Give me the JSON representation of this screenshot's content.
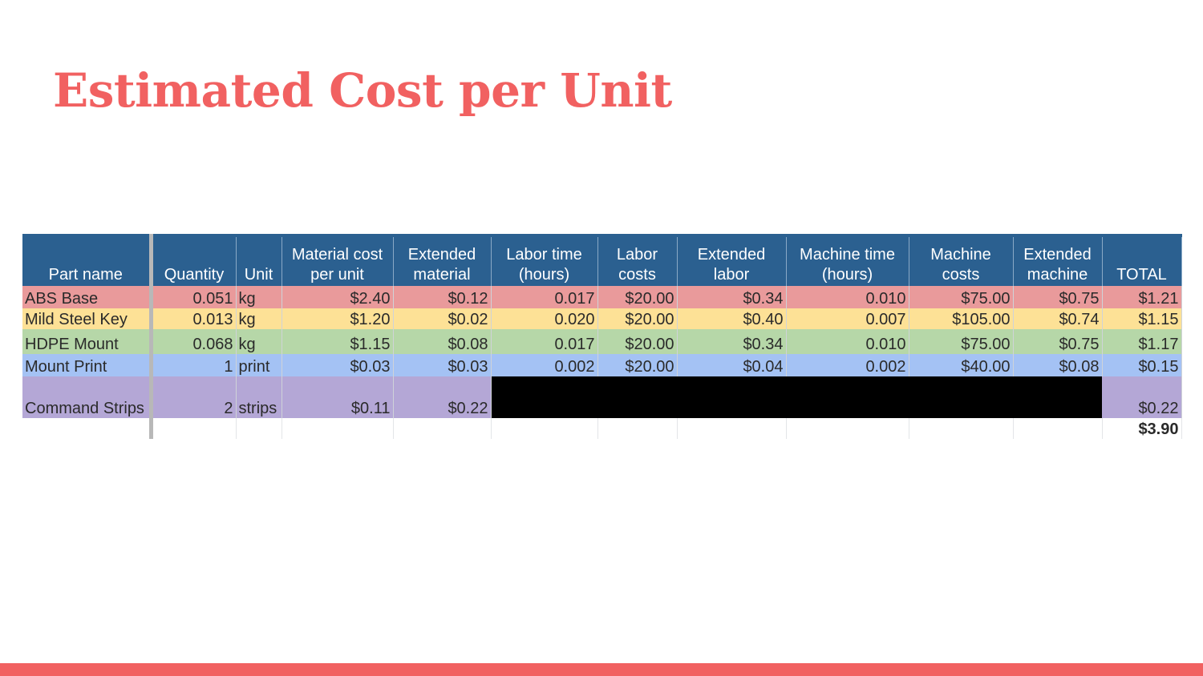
{
  "title": "Estimated Cost per Unit",
  "colors": {
    "accent": "#f16161",
    "header": "#2b6090"
  },
  "table": {
    "headers": [
      "Part name",
      "Quantity",
      "Unit",
      "Material cost per unit",
      "Extended material",
      "Labor time (hours)",
      "Labor costs",
      "Extended labor",
      "Machine time (hours)",
      "Machine costs",
      "Extended machine",
      "TOTAL"
    ],
    "rows": [
      {
        "part": "ABS Base",
        "qty": "0.051",
        "unit": "kg",
        "mat_cost": "$2.40",
        "ext_mat": "$0.12",
        "labor_time": "0.017",
        "labor_cost": "$20.00",
        "ext_labor": "$0.34",
        "machine_time": "0.010",
        "machine_cost": "$75.00",
        "ext_machine": "$0.75",
        "total": "$1.21",
        "color": "#e99a9b"
      },
      {
        "part": "Mild Steel Key",
        "qty": "0.013",
        "unit": "kg",
        "mat_cost": "$1.20",
        "ext_mat": "$0.02",
        "labor_time": "0.020",
        "labor_cost": "$20.00",
        "ext_labor": "$0.40",
        "machine_time": "0.007",
        "machine_cost": "$105.00",
        "ext_machine": "$0.74",
        "total": "$1.15",
        "color": "#fde196"
      },
      {
        "part": "HDPE Mount",
        "qty": "0.068",
        "unit": "kg",
        "mat_cost": "$1.15",
        "ext_mat": "$0.08",
        "labor_time": "0.017",
        "labor_cost": "$20.00",
        "ext_labor": "$0.34",
        "machine_time": "0.010",
        "machine_cost": "$75.00",
        "ext_machine": "$0.75",
        "total": "$1.17",
        "color": "#b6d7a8"
      },
      {
        "part": "Mount Print",
        "qty": "1",
        "unit": "print",
        "mat_cost": "$0.03",
        "ext_mat": "$0.03",
        "labor_time": "0.002",
        "labor_cost": "$20.00",
        "ext_labor": "$0.04",
        "machine_time": "0.002",
        "machine_cost": "$40.00",
        "ext_machine": "$0.08",
        "total": "$0.15",
        "color": "#a4c2f4"
      },
      {
        "part": "Command Strips",
        "qty": "2",
        "unit": "strips",
        "mat_cost": "$0.11",
        "ext_mat": "$0.22",
        "total": "$0.22",
        "color": "#b4a7d6"
      }
    ],
    "grand_total": "$3.90"
  }
}
